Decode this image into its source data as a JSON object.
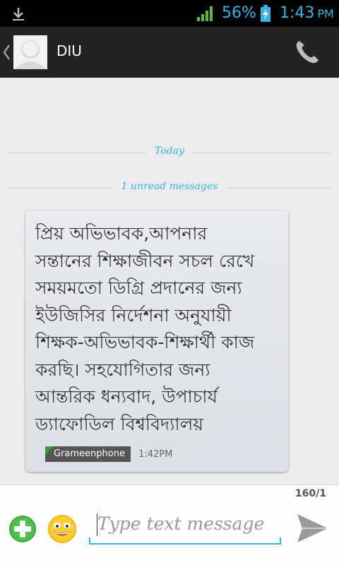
{
  "status_bar": {
    "battery_percent": "56%",
    "time": "1:43",
    "ampm": "PM",
    "icons": [
      "download-icon",
      "signal-icon",
      "battery-charging-icon"
    ]
  },
  "action_bar": {
    "contact_name": "DIU",
    "icons": [
      "back-icon",
      "avatar",
      "phone-icon"
    ]
  },
  "conversation": {
    "date_divider": "Today",
    "unread_divider": "1 unread messages",
    "message": {
      "lines": [
        "প্রিয় অভিভাবক,আপনার",
        "সন্তানের শিক্ষাজীবন সচল রেখে",
        "সময়মতো ডিগ্রি প্রদানের জন্য",
        "ইউজিসির নির্দেশনা অনুযায়ী",
        "শিক্ষক-অভিভাবক-শিক্ষার্থী কাজ",
        "করছি। সহযোগিতার জন্য",
        "আন্তরিক ধন্যবাদ, উপাচার্য",
        "ড্যাফোডিল বিশ্ববিদ্যালয়"
      ],
      "sim_label": "Grameenphone",
      "timestamp": "1:42PM"
    }
  },
  "compose": {
    "counter": "160/1",
    "placeholder": "Type text message",
    "icons": [
      "add-attachment-icon",
      "emoji-icon",
      "send-icon"
    ]
  },
  "colors": {
    "accent": "#33b5e5",
    "action_bar": "#222222",
    "status_bar": "#000000",
    "background": "#ececec",
    "bubble": "#e2e5e9",
    "sim_badge": "#555555",
    "sim_flag": "#3a9a3a",
    "add_button": "#3ca33c"
  }
}
